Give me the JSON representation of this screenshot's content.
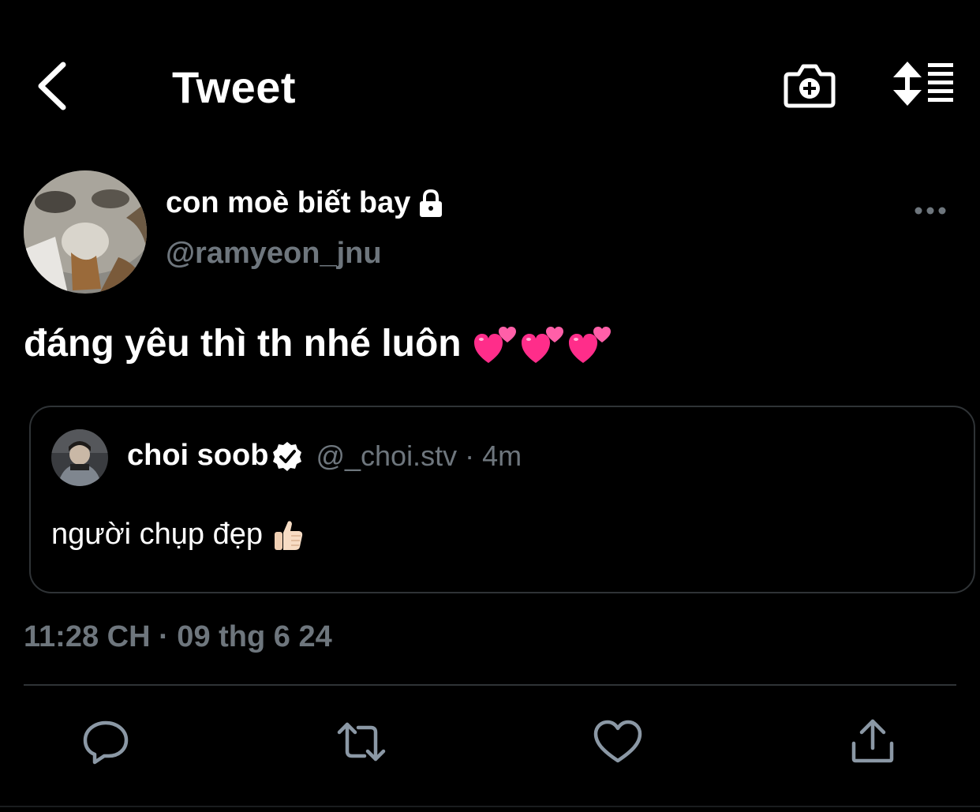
{
  "header": {
    "title": "Tweet",
    "back_icon": "chevron-left-icon",
    "camera_icon": "camera-add-icon",
    "sort_icon": "sort-list-icon"
  },
  "author": {
    "display_name": "con moè biết bay",
    "handle": "@ramyeon_jnu",
    "protected_icon": "lock-icon",
    "avatar": "cat-photo-avatar",
    "more_icon": "more-horizontal-icon"
  },
  "tweet": {
    "text": "đáng yêu thì th nhé luôn",
    "emojis": [
      "two-hearts",
      "two-hearts",
      "two-hearts"
    ]
  },
  "quote": {
    "name": "choi soob",
    "verified_icon": "verified-badge-icon",
    "handle": "@_choi.stv",
    "separator": "·",
    "time": "4m",
    "text": "người chụp đẹp",
    "emoji": "thumbs-up-light-skin"
  },
  "timestamp": "11:28 CH · 09 thg 6 24",
  "actions": [
    "reply-icon",
    "retweet-icon",
    "like-icon",
    "share-icon"
  ],
  "colors": {
    "background": "#000000",
    "text_primary": "#ffffff",
    "text_secondary": "#6e767d",
    "border": "#2f3336",
    "heart_pink": "#ff2d8a"
  }
}
